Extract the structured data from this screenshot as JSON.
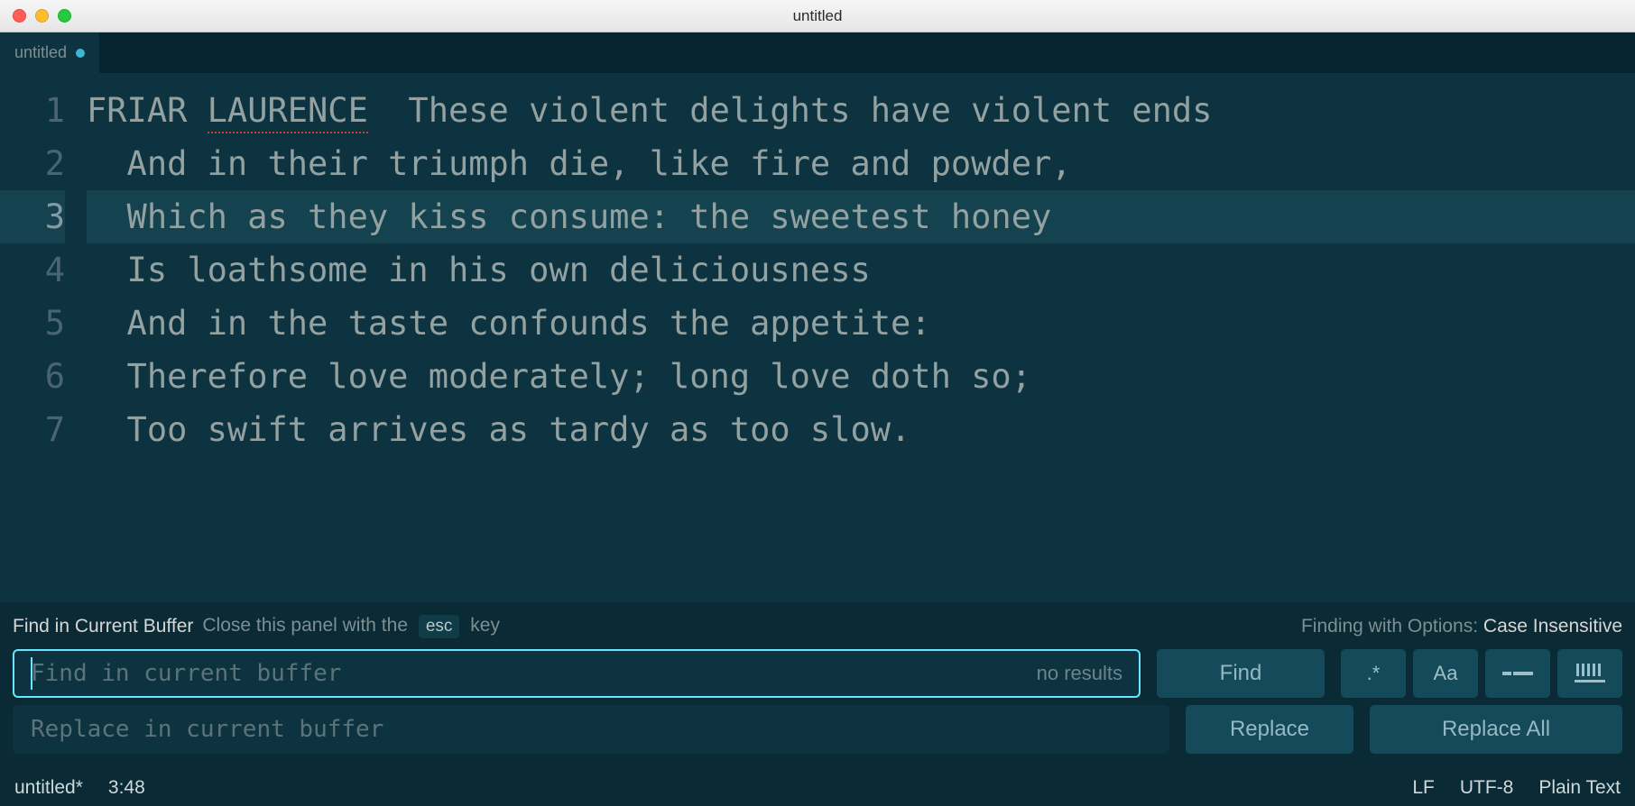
{
  "window": {
    "title": "untitled"
  },
  "tab": {
    "label": "untitled",
    "dirty": true
  },
  "editor": {
    "lines": [
      {
        "num": "1",
        "indent": "",
        "prefix": "FRIAR ",
        "spellerr": "LAURENCE",
        "rest": "  These violent delights have violent ends",
        "active": false
      },
      {
        "num": "2",
        "indent": "  ",
        "text": "And in their triumph die, like fire and powder,",
        "active": false
      },
      {
        "num": "3",
        "indent": "  ",
        "text": "Which as they kiss consume: the sweetest honey",
        "active": true
      },
      {
        "num": "4",
        "indent": "  ",
        "text": "Is loathsome in his own deliciousness",
        "active": false
      },
      {
        "num": "5",
        "indent": "  ",
        "text": "And in the taste confounds the appetite:",
        "active": false
      },
      {
        "num": "6",
        "indent": "  ",
        "text": "Therefore love moderately; long love doth so;",
        "active": false
      },
      {
        "num": "7",
        "indent": "  ",
        "text": "Too swift arrives as tardy as too slow.",
        "active": false
      }
    ]
  },
  "find": {
    "title": "Find in Current Buffer",
    "hint_pre": "Close this panel with the",
    "esc": "esc",
    "hint_post": "key",
    "options_label": "Finding with Options:",
    "options_value": "Case Insensitive",
    "find_placeholder": "Find in current buffer",
    "no_results": "no results",
    "find_btn": "Find",
    "replace_placeholder": "Replace in current buffer",
    "replace_btn": "Replace",
    "replace_all_btn": "Replace All",
    "opt_regex": ".*",
    "opt_case": "Aa"
  },
  "status": {
    "file": "untitled*",
    "pos": "3:48",
    "eol": "LF",
    "encoding": "UTF-8",
    "grammar": "Plain Text"
  }
}
